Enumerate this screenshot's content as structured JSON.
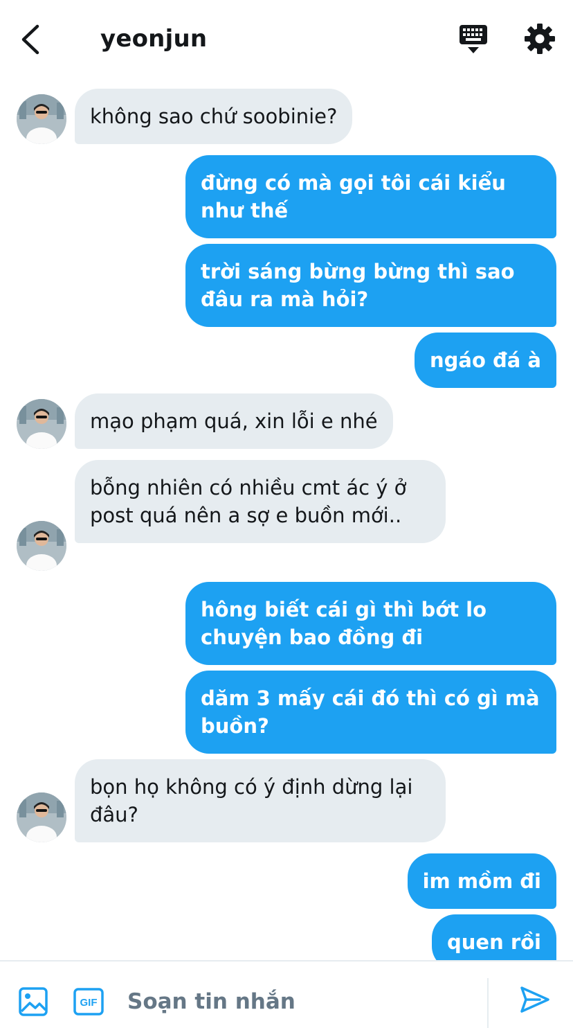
{
  "header": {
    "title": "yeonjun",
    "back_icon": "chevron-left-icon",
    "keyboard_icon": "keyboard-icon",
    "settings_icon": "gear-icon"
  },
  "colors": {
    "outgoing_bubble": "#1da1f2",
    "incoming_bubble": "#e6ecf0",
    "text_dark": "#14171a",
    "text_muted": "#657786"
  },
  "messages": [
    {
      "from": "them",
      "text": "không sao chứ soobinie?"
    },
    {
      "from": "me",
      "text": "đừng có mà gọi tôi cái kiểu như thế"
    },
    {
      "from": "me",
      "text": "trời sáng bừng bừng thì sao đâu ra mà hỏi?"
    },
    {
      "from": "me",
      "text": "ngáo đá à"
    },
    {
      "from": "them",
      "text": "mạo phạm quá, xin lỗi e nhé"
    },
    {
      "from": "them",
      "text": "bỗng nhiên có nhiều cmt ác ý ở post quá nên a sợ e buồn mới.."
    },
    {
      "from": "me",
      "text": "hông biết cái gì thì bớt lo chuyện bao đồng đi"
    },
    {
      "from": "me",
      "text": "dăm 3 mấy cái đó thì có gì mà buồn?"
    },
    {
      "from": "them",
      "text": "bọn họ không có ý định dừng lại đâu?"
    },
    {
      "from": "me",
      "text": "im mồm đi"
    },
    {
      "from": "me",
      "text": "quen rồi"
    }
  ],
  "composer": {
    "placeholder": "Soạn tin nhắn",
    "image_icon": "image-icon",
    "gif_icon": "gif-icon",
    "gif_label": "GIF",
    "send_icon": "send-icon"
  }
}
